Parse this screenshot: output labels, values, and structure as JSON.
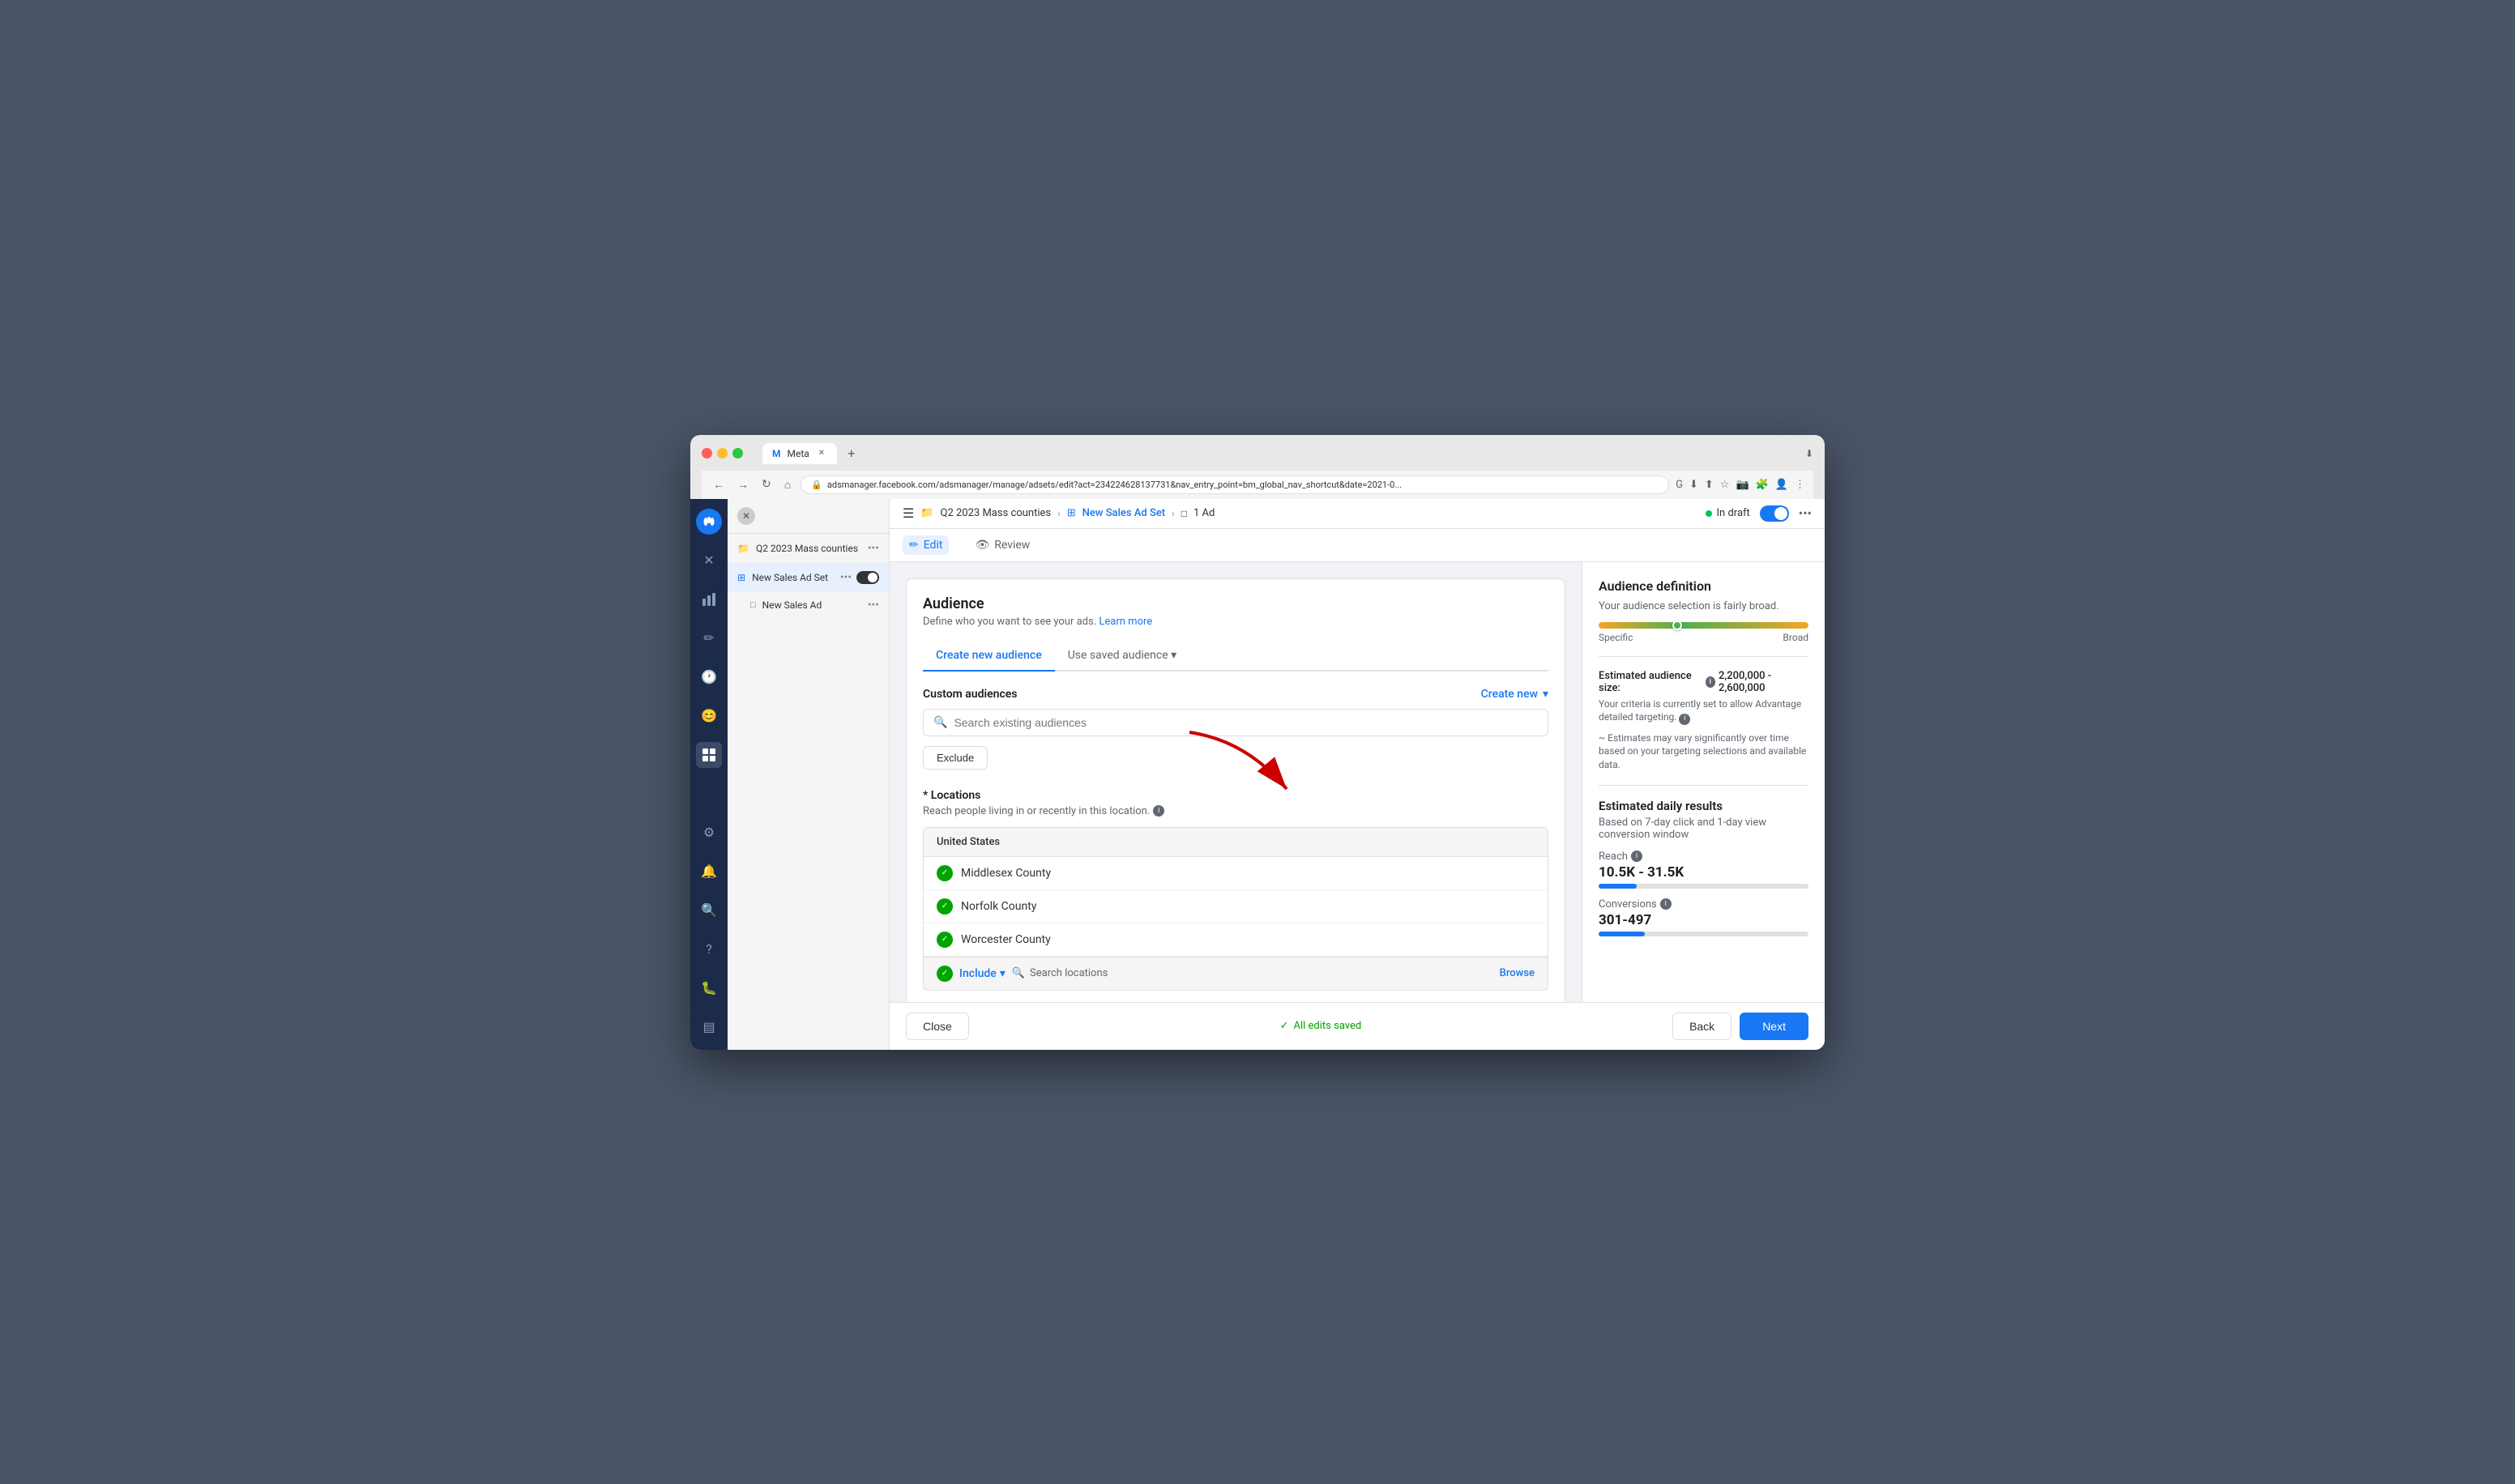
{
  "browser": {
    "url": "adsmanager.facebook.com/adsmanager/manage/adsets/edit?act=234224628137731&nav_entry_point=bm_global_nav_shortcut&date=2021-0...",
    "tab_title": "Meta",
    "tab_favicon": "M"
  },
  "breadcrumb": {
    "campaign": "Q2 2023 Mass counties",
    "adset": "New Sales Ad Set",
    "ad": "1 Ad"
  },
  "status": {
    "label": "In draft",
    "enabled": true
  },
  "edit_label": "Edit",
  "review_label": "Review",
  "sidebar": {
    "campaign_label": "Q2 2023 Mass counties",
    "adset_label": "New Sales Ad Set",
    "ad_label": "New Sales Ad"
  },
  "audience_section": {
    "title": "Audience",
    "subtitle": "Define who you want to see your ads.",
    "learn_more": "Learn more",
    "tab_create": "Create new audience",
    "tab_saved": "Use saved audience",
    "custom_audiences_label": "Custom audiences",
    "create_new_label": "Create new",
    "search_placeholder": "Search existing audiences",
    "exclude_label": "Exclude",
    "locations_title": "* Locations",
    "locations_subtitle": "Reach people living in or recently in this location.",
    "country": "United States",
    "locations": [
      "Middlesex County",
      "Norfolk County",
      "Worcester County"
    ],
    "include_label": "Include",
    "search_locations_placeholder": "Search locations",
    "browse_label": "Browse"
  },
  "right_panel": {
    "title": "Audience definition",
    "broad_text": "Your audience selection is fairly broad.",
    "specific_label": "Specific",
    "broad_label": "Broad",
    "est_size_label": "Estimated audience size:",
    "est_size_value": "2,200,000 - 2,600,000",
    "criteria_text": "Your criteria is currently set to allow Advantage detailed targeting.",
    "estimate_note": "Estimates may vary significantly over time based on your targeting selections and available data.",
    "est_daily_title": "Estimated daily results",
    "est_daily_subtitle": "Based on 7-day click and 1-day view conversion window",
    "reach_label": "Reach",
    "reach_value": "10.5K - 31.5K",
    "reach_bar_pct": 18,
    "conversions_label": "Conversions",
    "conversions_value": "301-497",
    "conversions_bar_pct": 22
  },
  "bottom_bar": {
    "close_label": "Close",
    "save_status": "All edits saved",
    "back_label": "Back",
    "next_label": "Next"
  }
}
